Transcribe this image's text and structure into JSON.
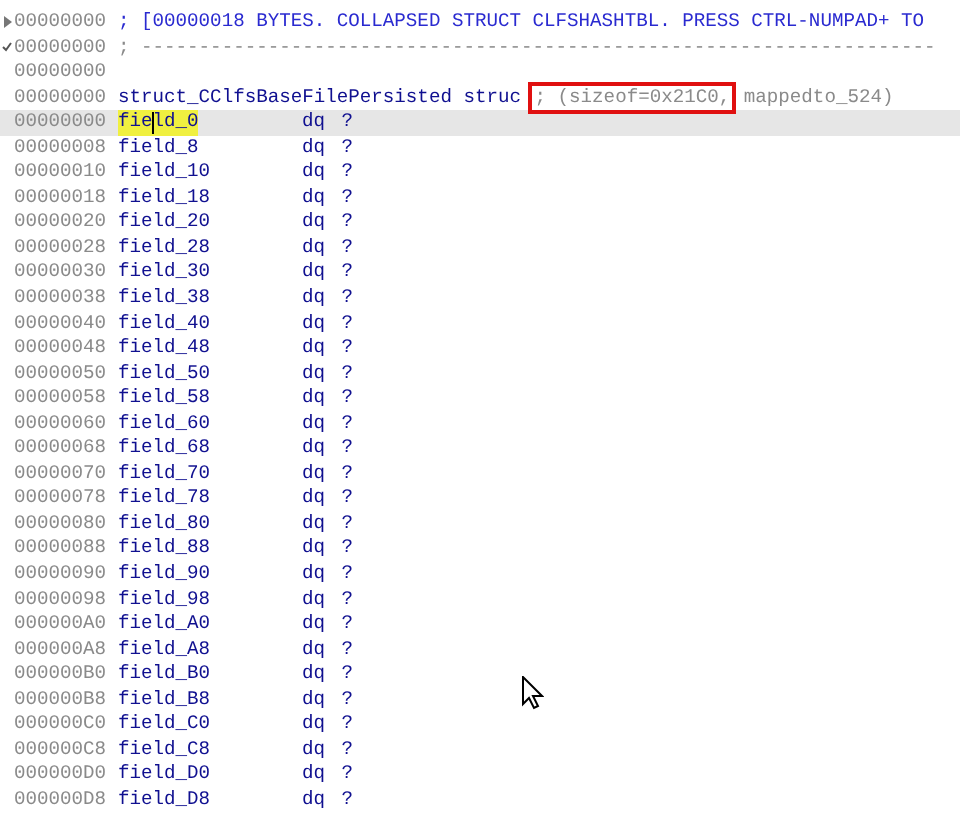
{
  "lines": [
    {
      "kind": "collapsed",
      "address": "00000000",
      "text": "; [00000018 BYTES. COLLAPSED STRUCT CLFSHASHTBL. PRESS CTRL-NUMPAD+ TO"
    },
    {
      "kind": "separator",
      "address": "00000000",
      "text": "; ---------------------------------------------------------------------"
    },
    {
      "kind": "blank",
      "address": "00000000"
    },
    {
      "kind": "struct",
      "address": "00000000",
      "name": "struct_CClfsBaseFilePersisted",
      "keyword": "struc",
      "comment_boxed": "; (sizeof=0x21C0,",
      "comment_rest": "mappedto_524)"
    },
    {
      "kind": "field",
      "address": "00000000",
      "name": "field_0",
      "type": "dq",
      "value": "?",
      "selected": true
    },
    {
      "kind": "field",
      "address": "00000008",
      "name": "field_8",
      "type": "dq",
      "value": "?",
      "selected": false
    },
    {
      "kind": "field",
      "address": "00000010",
      "name": "field_10",
      "type": "dq",
      "value": "?",
      "selected": false
    },
    {
      "kind": "field",
      "address": "00000018",
      "name": "field_18",
      "type": "dq",
      "value": "?",
      "selected": false
    },
    {
      "kind": "field",
      "address": "00000020",
      "name": "field_20",
      "type": "dq",
      "value": "?",
      "selected": false
    },
    {
      "kind": "field",
      "address": "00000028",
      "name": "field_28",
      "type": "dq",
      "value": "?",
      "selected": false
    },
    {
      "kind": "field",
      "address": "00000030",
      "name": "field_30",
      "type": "dq",
      "value": "?",
      "selected": false
    },
    {
      "kind": "field",
      "address": "00000038",
      "name": "field_38",
      "type": "dq",
      "value": "?",
      "selected": false
    },
    {
      "kind": "field",
      "address": "00000040",
      "name": "field_40",
      "type": "dq",
      "value": "?",
      "selected": false
    },
    {
      "kind": "field",
      "address": "00000048",
      "name": "field_48",
      "type": "dq",
      "value": "?",
      "selected": false
    },
    {
      "kind": "field",
      "address": "00000050",
      "name": "field_50",
      "type": "dq",
      "value": "?",
      "selected": false
    },
    {
      "kind": "field",
      "address": "00000058",
      "name": "field_58",
      "type": "dq",
      "value": "?",
      "selected": false
    },
    {
      "kind": "field",
      "address": "00000060",
      "name": "field_60",
      "type": "dq",
      "value": "?",
      "selected": false
    },
    {
      "kind": "field",
      "address": "00000068",
      "name": "field_68",
      "type": "dq",
      "value": "?",
      "selected": false
    },
    {
      "kind": "field",
      "address": "00000070",
      "name": "field_70",
      "type": "dq",
      "value": "?",
      "selected": false
    },
    {
      "kind": "field",
      "address": "00000078",
      "name": "field_78",
      "type": "dq",
      "value": "?",
      "selected": false
    },
    {
      "kind": "field",
      "address": "00000080",
      "name": "field_80",
      "type": "dq",
      "value": "?",
      "selected": false
    },
    {
      "kind": "field",
      "address": "00000088",
      "name": "field_88",
      "type": "dq",
      "value": "?",
      "selected": false
    },
    {
      "kind": "field",
      "address": "00000090",
      "name": "field_90",
      "type": "dq",
      "value": "?",
      "selected": false
    },
    {
      "kind": "field",
      "address": "00000098",
      "name": "field_98",
      "type": "dq",
      "value": "?",
      "selected": false
    },
    {
      "kind": "field",
      "address": "000000A0",
      "name": "field_A0",
      "type": "dq",
      "value": "?",
      "selected": false
    },
    {
      "kind": "field",
      "address": "000000A8",
      "name": "field_A8",
      "type": "dq",
      "value": "?",
      "selected": false
    },
    {
      "kind": "field",
      "address": "000000B0",
      "name": "field_B0",
      "type": "dq",
      "value": "?",
      "selected": false
    },
    {
      "kind": "field",
      "address": "000000B8",
      "name": "field_B8",
      "type": "dq",
      "value": "?",
      "selected": false
    },
    {
      "kind": "field",
      "address": "000000C0",
      "name": "field_C0",
      "type": "dq",
      "value": "?",
      "selected": false
    },
    {
      "kind": "field",
      "address": "000000C8",
      "name": "field_C8",
      "type": "dq",
      "value": "?",
      "selected": false
    },
    {
      "kind": "field",
      "address": "000000D0",
      "name": "field_D0",
      "type": "dq",
      "value": "?",
      "selected": false
    },
    {
      "kind": "field",
      "address": "000000D8",
      "name": "field_D8",
      "type": "dq",
      "value": "?",
      "selected": false
    }
  ]
}
